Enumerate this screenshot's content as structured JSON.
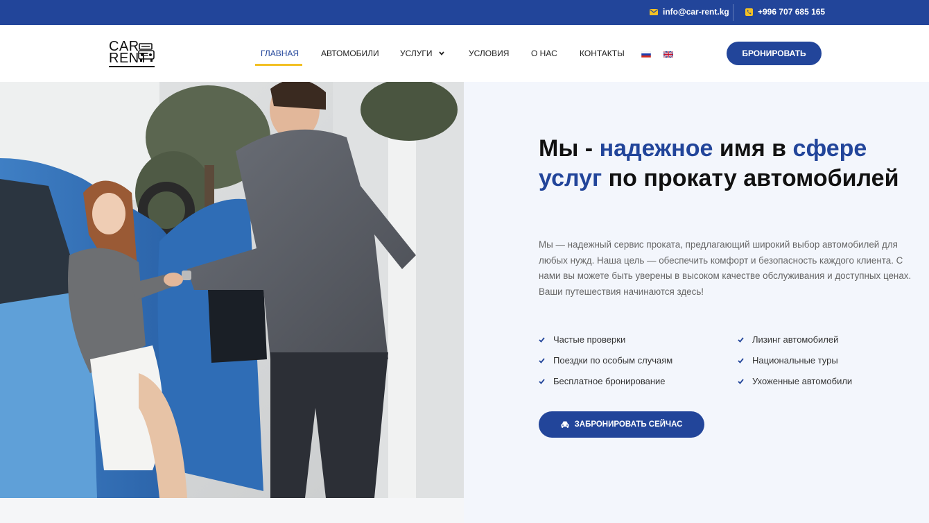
{
  "topbar": {
    "email": "info@car-rent.kg",
    "phone": "+996 707 685 165"
  },
  "logo": {
    "line1": "CAR",
    "line2": "RENT"
  },
  "nav": {
    "items": [
      {
        "label": "ГЛАВНАЯ",
        "active": true
      },
      {
        "label": "АВТОМОБИЛИ"
      },
      {
        "label": "УСЛУГИ",
        "dropdown": true
      },
      {
        "label": "УСЛОВИЯ"
      },
      {
        "label": "О НАС"
      },
      {
        "label": "КОНТАКТЫ"
      }
    ],
    "languages": [
      "ru-flag",
      "en-flag"
    ],
    "book_label": "БРОНИРОВАТЬ"
  },
  "hero": {
    "headline": {
      "p1": "Мы - ",
      "p2": "надежное",
      "p3": " имя в ",
      "p4": "сфере услуг",
      "p5": " по прокату автомобилей"
    },
    "description": "Мы — надежный сервис проката, предлагающий широкий выбор автомобилей для любых нужд. Наша цель — обеспечить комфорт и безопасность каждого клиента. С нами вы можете быть уверены в высоком качестве обслуживания и доступных ценах. Ваши путешествия начинаются здесь!",
    "features": [
      "Частые проверки",
      "Лизинг автомобилей",
      "Поездки по особым случаям",
      "Национальные туры",
      "Бесплатное бронирование",
      "Ухоженные автомобили"
    ],
    "cta_label": "ЗАБРОНИРОВАТЬ СЕЙЧАС"
  },
  "colors": {
    "brand": "#22459a",
    "accent": "#f2c024",
    "hero_bg": "#f3f6fc"
  }
}
